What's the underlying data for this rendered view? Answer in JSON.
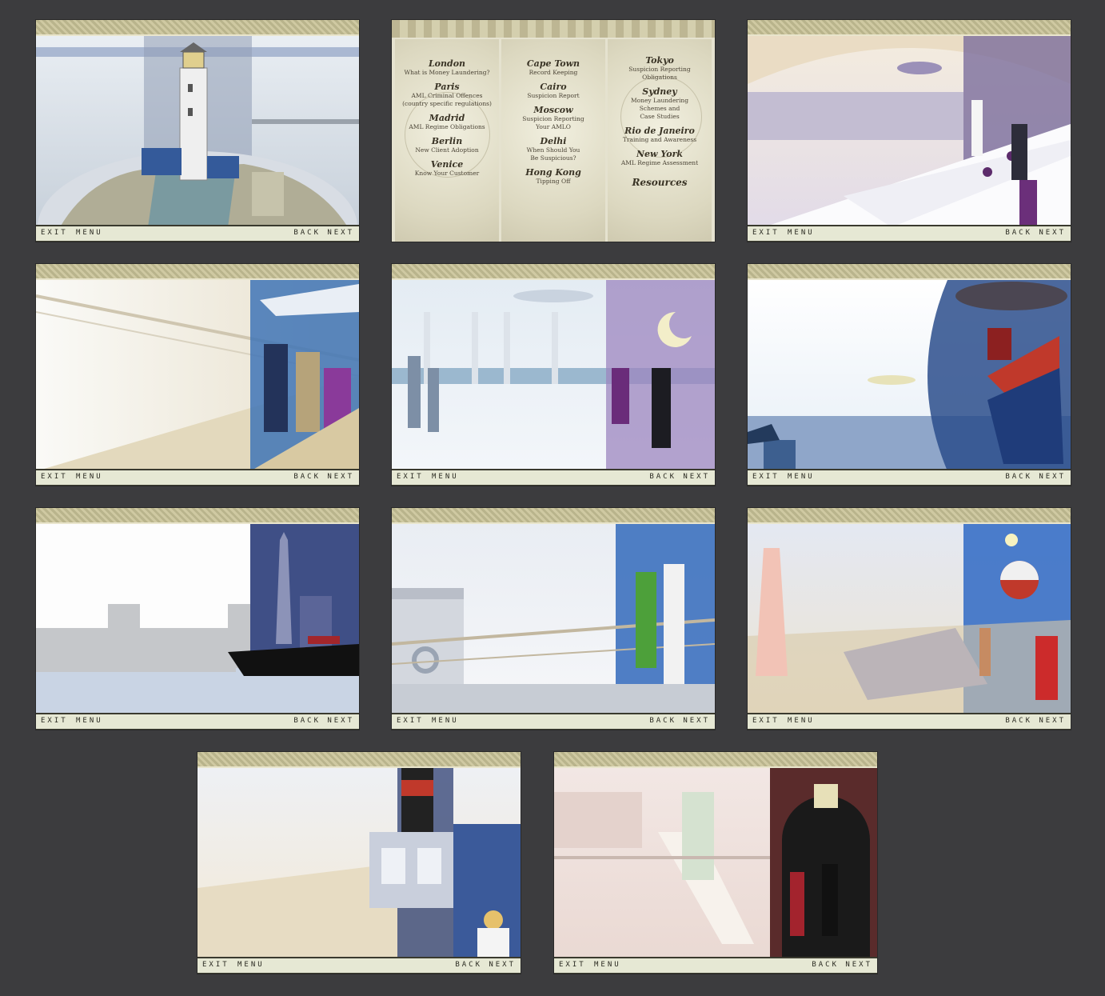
{
  "footer": {
    "exit": "EXIT",
    "menu": "MENU",
    "back": "BACK",
    "next": "NEXT"
  },
  "menu_book": {
    "columns": [
      [
        {
          "city": "London",
          "topics": [
            "What is Money Laundering?"
          ]
        },
        {
          "city": "Paris",
          "topics": [
            "AML Criminal Offences",
            "(country specific regulations)"
          ]
        },
        {
          "city": "Madrid",
          "topics": [
            "AML Regime Obligations"
          ]
        },
        {
          "city": "Berlin",
          "topics": [
            "New Client Adoption"
          ]
        },
        {
          "city": "Venice",
          "topics": [
            "Know Your Customer"
          ]
        }
      ],
      [
        {
          "city": "Cape Town",
          "topics": [
            "Record Keeping"
          ]
        },
        {
          "city": "Cairo",
          "topics": [
            "Suspicion Report"
          ]
        },
        {
          "city": "Moscow",
          "topics": [
            "Suspicion Reporting",
            "Your AMLO"
          ]
        },
        {
          "city": "Delhi",
          "topics": [
            "When Should You",
            "Be Suspicious?"
          ]
        },
        {
          "city": "Hong Kong",
          "topics": [
            "Tipping Off"
          ]
        }
      ],
      [
        {
          "city": "Tokyo",
          "topics": [
            "Suspicion Reporting",
            "Obligations"
          ]
        },
        {
          "city": "Sydney",
          "topics": [
            "Money Laundering",
            "Schemes and",
            "Case Studies"
          ]
        },
        {
          "city": "Rio de Janeiro",
          "topics": [
            "Training and Awareness"
          ]
        },
        {
          "city": "New York",
          "topics": [
            "AML Regime Assessment"
          ]
        }
      ]
    ],
    "resources": "Resources"
  },
  "scenes": [
    "lighthouse",
    "menu",
    "dining-room",
    "deck-chairs",
    "ballroom",
    "liner-at-sea",
    "new-york-arrival",
    "promenade-deck",
    "pool-deck",
    "funnel-deck",
    "grand-staircase"
  ],
  "colors": {
    "background": "#3c3c3e",
    "header_pattern": "#b9b48c",
    "footer_bar": "#e6e8d4"
  }
}
